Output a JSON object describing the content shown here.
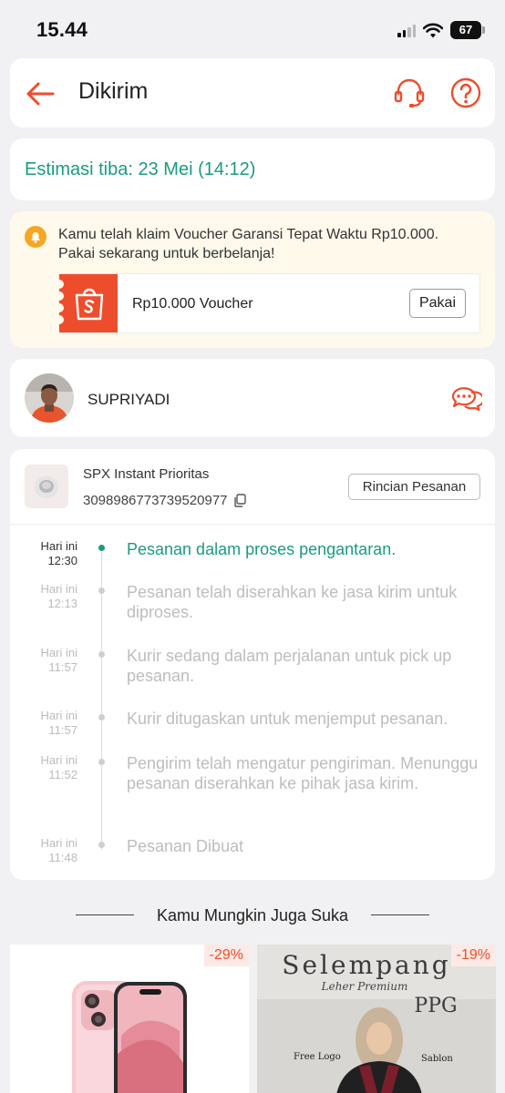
{
  "status_bar": {
    "time": "15.44",
    "battery": "67"
  },
  "header": {
    "title": "Dikirim"
  },
  "eta": {
    "text": "Estimasi tiba: 23 Mei (14:12)"
  },
  "voucher": {
    "message": "Kamu telah klaim Voucher Garansi Tepat Waktu Rp10.000. Pakai sekarang untuk berbelanja!",
    "title": "Rp10.000 Voucher",
    "button": "Pakai"
  },
  "courier": {
    "name": "SUPRIYADI"
  },
  "shipment": {
    "service": "SPX Instant Prioritas",
    "tracking_number": "3098986773739520977",
    "details_button": "Rincian Pesanan"
  },
  "timeline": [
    {
      "day": "Hari ini",
      "time": "12:30",
      "desc": "Pesanan dalam proses pengantaran.",
      "active": true
    },
    {
      "day": "Hari ini",
      "time": "12:13",
      "desc": "Pesanan telah diserahkan ke jasa kirim untuk diproses.",
      "active": false
    },
    {
      "day": "Hari ini",
      "time": "11:57",
      "desc": "Kurir sedang dalam perjalanan untuk pick up pesanan.",
      "active": false
    },
    {
      "day": "Hari ini",
      "time": "11:57",
      "desc": "Kurir ditugaskan untuk menjemput pesanan.",
      "active": false
    },
    {
      "day": "Hari ini",
      "time": "11:52",
      "desc": "Pengirim telah mengatur pengiriman. Menunggu pesanan diserahkan ke pihak jasa kirim.",
      "active": false
    },
    {
      "day": "Hari ini",
      "time": "11:48",
      "desc": "Pesanan Dibuat",
      "active": false
    }
  ],
  "recommendations": {
    "title": "Kamu Mungkin Juga Suka",
    "items": [
      {
        "discount": "-29%"
      },
      {
        "discount": "-19%",
        "banner_title": "Selempang",
        "banner_subtitle": "Leher Premium",
        "banner_code": "PPG",
        "tag_left": "Free Logo",
        "tag_right": "Sablon"
      }
    ]
  },
  "colors": {
    "accent": "#ee4d2d",
    "teal": "#1a9b80",
    "voucher_bg": "#fff9ec"
  }
}
